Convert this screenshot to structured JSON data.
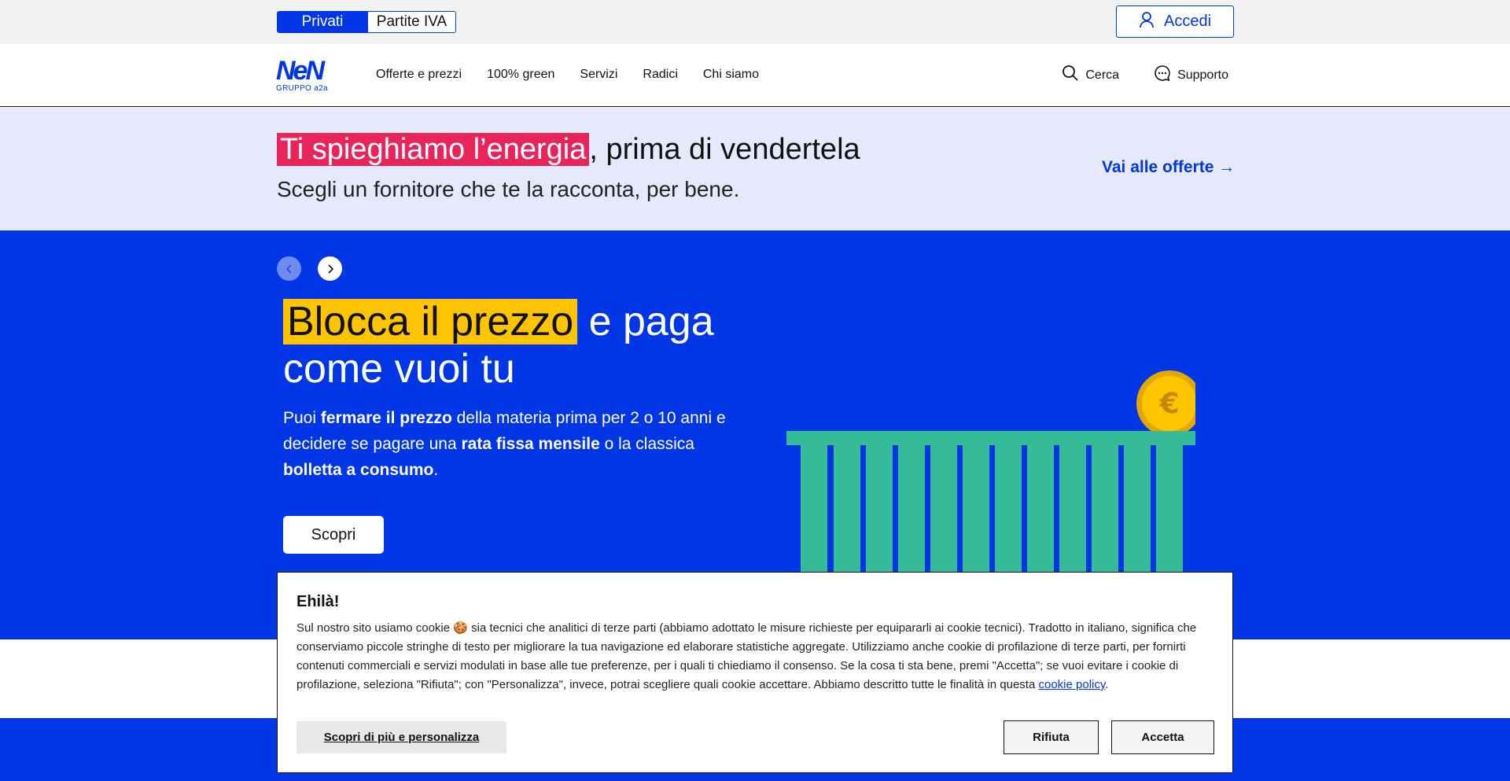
{
  "topbar": {
    "segment": {
      "active": "Privati",
      "inactive": "Partite IVA"
    },
    "login_label": "Accedi"
  },
  "brand": {
    "logo_text": "NeN",
    "logo_sub": "GRUPPO a2a"
  },
  "nav": {
    "items": [
      "Offerte e prezzi",
      "100% green",
      "Servizi",
      "Radici",
      "Chi siamo"
    ],
    "search_label": "Cerca",
    "support_label": "Supporto"
  },
  "promo": {
    "title_highlight": "Ti spieghiamo l’energia",
    "title_rest": ", prima di vendertela",
    "subtitle": "Scegli un fornitore che te la racconta, per bene.",
    "link_label": "Vai alle offerte",
    "link_arrow": "→"
  },
  "hero": {
    "title_highlight": "Blocca il prezzo",
    "title_rest": " e paga come vuoi tu",
    "desc_1": "Puoi ",
    "desc_b1": "fermare il prezzo",
    "desc_2": " della materia prima per 2 o 10 anni e decidere se pagare una ",
    "desc_b2": "rata fissa mensile",
    "desc_3": " o la classica ",
    "desc_b3": "bolletta a consumo",
    "desc_4": ".",
    "button_label": "Scopri",
    "coin_symbol": "€"
  },
  "cookie": {
    "title": "Ehilà!",
    "text_before": "Sul nostro sito usiamo cookie 🍪 sia tecnici che analitici di terze parti (abbiamo adottato le misure richieste per equipararli ai cookie tecnici). Tradotto in italiano, significa che conserviamo piccole stringhe di testo per migliorare la tua navigazione ed elaborare statistiche aggregate. Utilizziamo anche cookie di profilazione di terze parti, per fornirti contenuti commerciali e servizi modulati in base alle tue preferenze, per i quali ti chiediamo il consenso. Se la cosa ti sta bene, premi \"Accetta\"; se vuoi evitare i cookie di profilazione, seleziona \"Rifiuta\"; con \"Personalizza\", invece, potrai scegliere quali cookie accettare. Abbiamo descritto tutte le finalità in questa ",
    "policy_link": "cookie policy",
    "text_after": ".",
    "more_label": "Scopri di più e personalizza",
    "refuse_label": "Rifiuta",
    "accept_label": "Accetta"
  },
  "colors": {
    "brand_blue": "#0036e6",
    "highlight_pink": "#e8245a",
    "highlight_yellow": "#ffc400",
    "promo_bg": "#e6e9fb",
    "illustration_green": "#36bb98"
  }
}
